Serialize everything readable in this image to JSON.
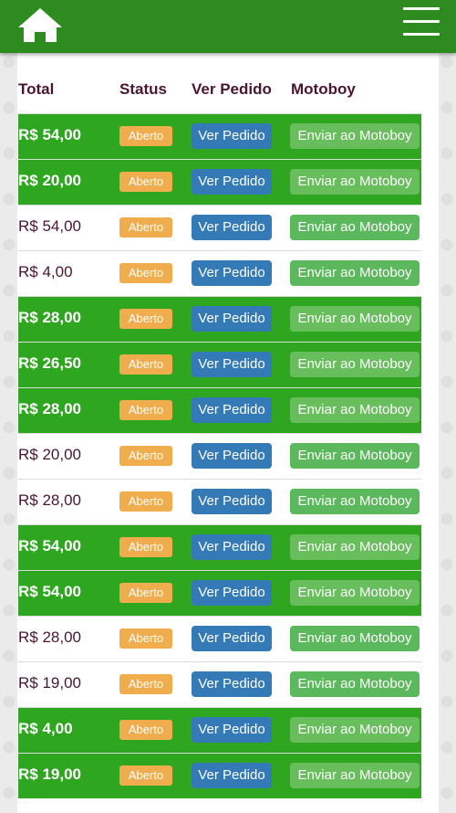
{
  "header": {
    "home_icon": "home-icon",
    "menu_icon": "hamburger-menu-icon",
    "background_color": "#2e8b20"
  },
  "table": {
    "columns": [
      "Total",
      "Status",
      "Ver Pedido",
      "Motoboy"
    ],
    "rows": [
      {
        "total": "R$ 54,00",
        "status": "Aberto",
        "view": "Ver Pedido",
        "send": "Enviar ao Motoboy",
        "highlight": true
      },
      {
        "total": "R$ 20,00",
        "status": "Aberto",
        "view": "Ver Pedido",
        "send": "Enviar ao Motoboy",
        "highlight": true
      },
      {
        "total": "R$ 54,00",
        "status": "Aberto",
        "view": "Ver Pedido",
        "send": "Enviar ao Motoboy",
        "highlight": false
      },
      {
        "total": "R$ 4,00",
        "status": "Aberto",
        "view": "Ver Pedido",
        "send": "Enviar ao Motoboy",
        "highlight": false
      },
      {
        "total": "R$ 28,00",
        "status": "Aberto",
        "view": "Ver Pedido",
        "send": "Enviar ao Motoboy",
        "highlight": true
      },
      {
        "total": "R$ 26,50",
        "status": "Aberto",
        "view": "Ver Pedido",
        "send": "Enviar ao Motoboy",
        "highlight": true
      },
      {
        "total": "R$ 28,00",
        "status": "Aberto",
        "view": "Ver Pedido",
        "send": "Enviar ao Motoboy",
        "highlight": true
      },
      {
        "total": "R$ 20,00",
        "status": "Aberto",
        "view": "Ver Pedido",
        "send": "Enviar ao Motoboy",
        "highlight": false
      },
      {
        "total": "R$ 28,00",
        "status": "Aberto",
        "view": "Ver Pedido",
        "send": "Enviar ao Motoboy",
        "highlight": false
      },
      {
        "total": "R$ 54,00",
        "status": "Aberto",
        "view": "Ver Pedido",
        "send": "Enviar ao Motoboy",
        "highlight": true
      },
      {
        "total": "R$ 54,00",
        "status": "Aberto",
        "view": "Ver Pedido",
        "send": "Enviar ao Motoboy",
        "highlight": true
      },
      {
        "total": "R$ 28,00",
        "status": "Aberto",
        "view": "Ver Pedido",
        "send": "Enviar ao Motoboy",
        "highlight": false
      },
      {
        "total": "R$ 19,00",
        "status": "Aberto",
        "view": "Ver Pedido",
        "send": "Enviar ao Motoboy",
        "highlight": false
      },
      {
        "total": "R$ 4,00",
        "status": "Aberto",
        "view": "Ver Pedido",
        "send": "Enviar ao Motoboy",
        "highlight": true
      },
      {
        "total": "R$ 19,00",
        "status": "Aberto",
        "view": "Ver Pedido",
        "send": "Enviar ao Motoboy",
        "highlight": true
      }
    ]
  },
  "colors": {
    "highlight_row": "#2fa61f",
    "status_badge": "#f0ad4e",
    "view_button": "#337ab7",
    "send_button": "#5cb85c",
    "header_text": "#4a1531"
  }
}
